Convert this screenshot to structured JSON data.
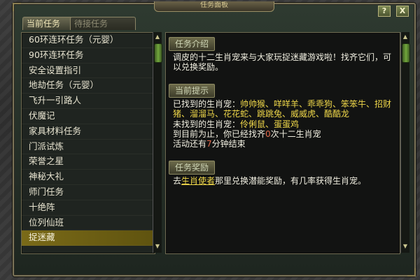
{
  "window": {
    "title": "任务面板",
    "help_label": "?",
    "close_label": "X"
  },
  "tabs": [
    {
      "label": "当前任务"
    },
    {
      "label": "待接任务"
    }
  ],
  "task_list": [
    {
      "label": "60环连环任务（元婴）"
    },
    {
      "label": "90环连环任务"
    },
    {
      "label": "安全设置指引"
    },
    {
      "label": "地劫任务（元婴）"
    },
    {
      "label": "飞升一引路人"
    },
    {
      "label": "伏魔记"
    },
    {
      "label": "家具材料任务"
    },
    {
      "label": "门派试炼"
    },
    {
      "label": "荣誉之星"
    },
    {
      "label": "神秘大礼"
    },
    {
      "label": "师门任务"
    },
    {
      "label": "十绝阵"
    },
    {
      "label": "位列仙班"
    },
    {
      "label": "捉迷藏"
    }
  ],
  "selected_index": 13,
  "detail": {
    "intro_title": "任务介绍",
    "intro_text": "调皮的十二生肖宠来与大家玩捉迷藏游戏啦！找齐它们，可以兑换奖励。",
    "tip_title": "当前提示",
    "found_label": "已找到的生肖宠：",
    "found_names": "帅帅猴、咩咩羊、乖乖狗、笨笨牛、招财猪、溜溜马、花花蛇、跳跳兔、威威虎、酷酷龙",
    "notfound_label": "未找到的生肖宠：",
    "notfound_names": "伶俐鼠、蛋蛋鸡",
    "progress_prefix": "到目前为止，你已经找齐",
    "progress_count": "0",
    "progress_suffix": "次十二生肖宠",
    "time_prefix": "活动还有",
    "time_value": "7",
    "time_suffix": "分钟结束",
    "reward_title": "任务奖励",
    "reward_prefix": "去",
    "reward_link": "生肖使者",
    "reward_suffix": "那里兑换潜能奖励，有几率获得生肖宠。"
  },
  "colors": {
    "accent": "#f0d84a",
    "selected_bg": "#7a6a18",
    "highlight_red": "#e56a4c",
    "scroll_thumb": "#72a83c"
  }
}
